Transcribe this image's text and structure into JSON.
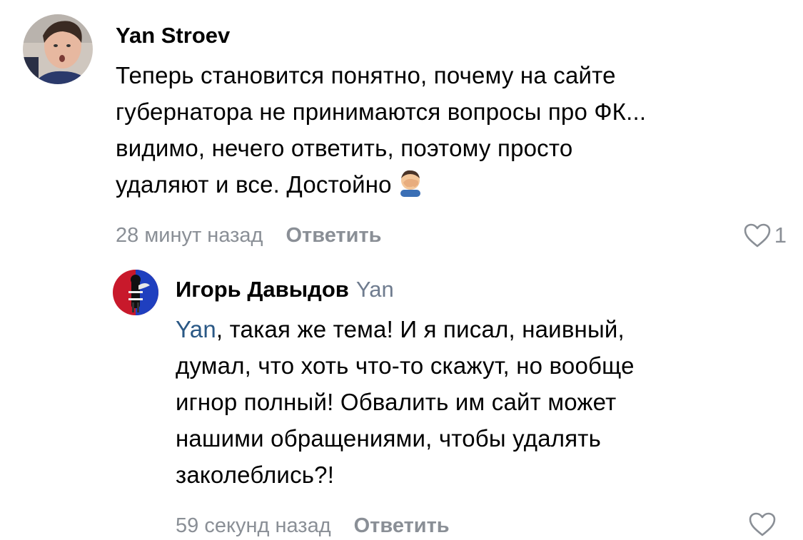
{
  "comments": [
    {
      "author": "Yan Stroev",
      "text_lines": [
        "Теперь становится понятно, почему на сайте",
        "губернатора не принимаются вопросы про ФК...",
        "видимо, нечего ответить, поэтому просто",
        "удаляют и все. Достойно"
      ],
      "emoji": "man-facepalming-emoji",
      "time": "28 минут назад",
      "reply_label": "Ответить",
      "likes": "1"
    },
    {
      "author": "Игорь Давыдов",
      "reply_to": "Yan",
      "mention": "Yan",
      "text_lines": [
        ", такая же тема! И я писал, наивный,",
        "думал, что хоть что-то скажут, но вообще",
        "игнор полный! Обвалить им сайт может",
        "нашими обращениями, чтобы удалять",
        "заколеблись?!"
      ],
      "time": "59 секунд назад",
      "reply_label": "Ответить"
    }
  ],
  "colors": {
    "meta": "#8a8f96",
    "mention": "#2a5885",
    "reply_to": "#6f7c8f"
  },
  "icons": {
    "like": "heart-outline-icon"
  }
}
